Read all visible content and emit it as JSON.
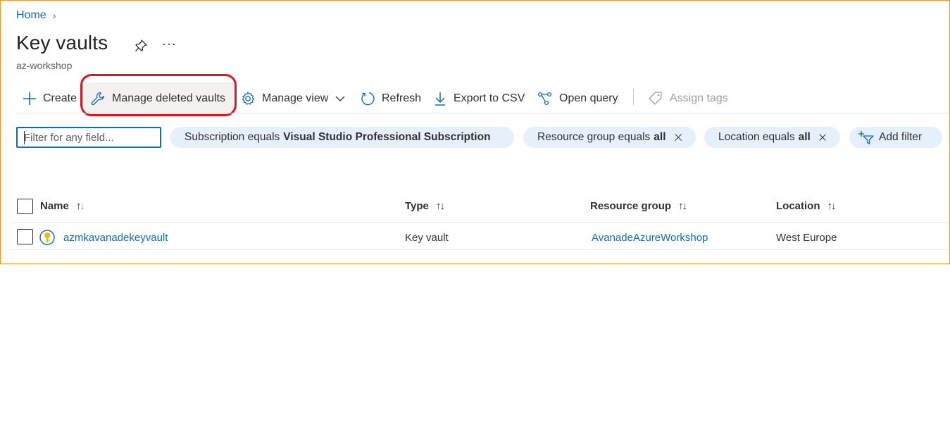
{
  "breadcrumb": {
    "home": "Home",
    "chevron": "›"
  },
  "page": {
    "title": "Key vaults",
    "subtitle": "az-workshop",
    "more": "···"
  },
  "toolbar": {
    "create": "Create",
    "manage_deleted": "Manage deleted vaults",
    "manage_view": "Manage view",
    "refresh": "Refresh",
    "export": "Export to CSV",
    "open_query": "Open query",
    "assign_tags": "Assign tags"
  },
  "filters": {
    "placeholder": "Filter for any field...",
    "subscription": {
      "label": "Subscription equals",
      "value": "Visual Studio Professional Subscription"
    },
    "resource_group": {
      "label": "Resource group equals",
      "value": "all"
    },
    "location": {
      "label": "Location equals",
      "value": "all"
    },
    "add_filter": "Add filter"
  },
  "table": {
    "columns": [
      "Name",
      "Type",
      "Resource group",
      "Location"
    ],
    "rows": [
      {
        "name": "azmkavanadekeyvault",
        "type": "Key vault",
        "resource_group": "AvanadeAzureWorkshop",
        "location": "West Europe"
      }
    ]
  },
  "colors": {
    "accent": "#0f6cbd",
    "highlight": "#e3141b",
    "frame": "#f0962a",
    "pill": "#e5f0fb"
  }
}
